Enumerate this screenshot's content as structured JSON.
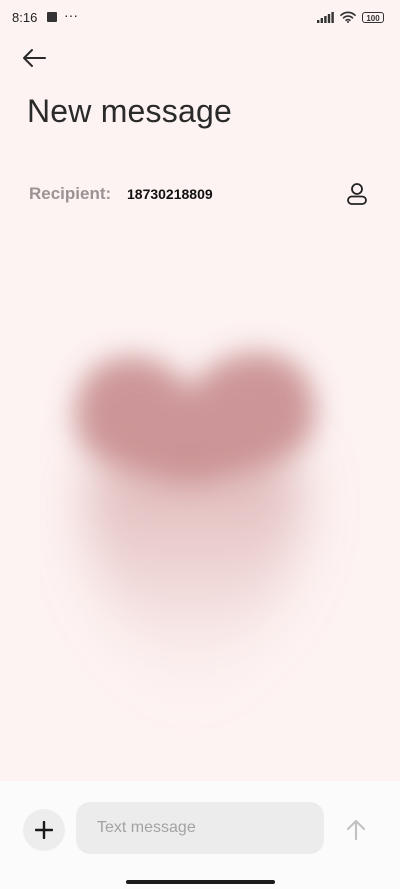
{
  "status_bar": {
    "time": "8:16",
    "overflow_indicator": "···",
    "battery_level": "100",
    "icons": [
      "app-notification-icon",
      "signal-icon",
      "wifi-icon",
      "battery-icon"
    ]
  },
  "header": {
    "back_icon": "arrow-left-icon",
    "title": "New message"
  },
  "recipient": {
    "label": "Recipient:",
    "value": "18730218809",
    "contact_icon": "person-icon"
  },
  "illustration": {
    "name": "heart",
    "color": "#c98f91"
  },
  "composer": {
    "add_icon": "plus-icon",
    "placeholder": "Text message",
    "value": "",
    "send_icon": "arrow-up-icon"
  },
  "colors": {
    "background": "#fdf3f2",
    "composer_background": "#fbfbfb",
    "input_background": "#ececec",
    "label_gray": "#9b9393"
  }
}
